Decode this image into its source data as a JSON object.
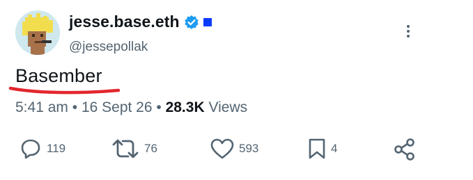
{
  "author": {
    "display_name": "jesse.base.eth",
    "handle": "@jessepollak",
    "verified_icon": "verified-badge-icon",
    "affiliate_icon": "blue-square-icon",
    "colors": {
      "verified": "#1d9bf0",
      "affiliate": "#0b3bff"
    }
  },
  "tweet": {
    "text": "Basember",
    "annotation_color": "#e3262d"
  },
  "meta": {
    "time": "5:41 am",
    "sep1": "•",
    "date": "16 Sept 26",
    "sep2": "•",
    "views_count": "28.3K",
    "views_label": "Views"
  },
  "actions": {
    "reply": {
      "icon": "reply-icon",
      "count": "119"
    },
    "retweet": {
      "icon": "retweet-icon",
      "count": "76"
    },
    "like": {
      "icon": "heart-icon",
      "count": "593"
    },
    "bookmark": {
      "icon": "bookmark-icon",
      "count": "4"
    },
    "share": {
      "icon": "share-icon"
    }
  },
  "menu": {
    "icon": "more-options-icon"
  }
}
